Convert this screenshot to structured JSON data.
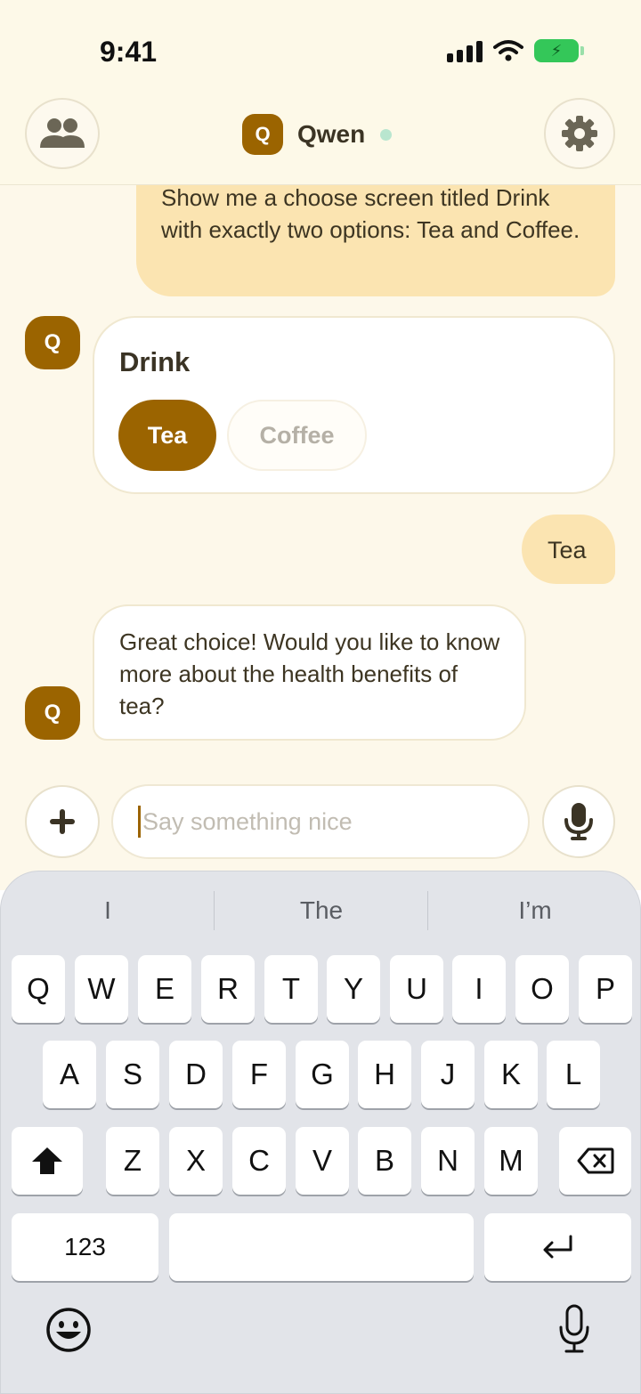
{
  "status_bar": {
    "time": "9:41"
  },
  "header": {
    "avatar_letter": "Q",
    "agent_name": "Qwen"
  },
  "messages": {
    "user_first": "Show me a choose screen titled Drink with exactly two options: Tea and Coffee.",
    "choose_card": {
      "avatar_letter": "Q",
      "title": "Drink",
      "options": [
        "Tea",
        "Coffee"
      ],
      "selected": "Tea"
    },
    "user_reply": "Tea",
    "bot_reply": "Great choice! Would you like to know more about the health benefits of tea?",
    "bot_avatar_letter": "Q"
  },
  "composer": {
    "placeholder": "Say something nice"
  },
  "keyboard": {
    "suggestions": [
      "I",
      "The",
      "I’m"
    ],
    "row1": [
      "Q",
      "W",
      "E",
      "R",
      "T",
      "Y",
      "U",
      "I",
      "O",
      "P"
    ],
    "row2": [
      "A",
      "S",
      "D",
      "F",
      "G",
      "H",
      "J",
      "K",
      "L"
    ],
    "row3": [
      "Z",
      "X",
      "C",
      "V",
      "B",
      "N",
      "M"
    ],
    "numbers_key": "123"
  },
  "icons": [
    "people-icon",
    "gear-icon",
    "plus-icon",
    "mic-icon",
    "shift-icon",
    "backspace-icon",
    "return-icon",
    "emoji-icon",
    "dictation-icon",
    "wifi-icon",
    "signal-icon",
    "battery-icon"
  ],
  "colors": {
    "accent": "#9b6400",
    "user_bubble": "#fbe4b1",
    "background": "#fdf8ea",
    "online": "#b9e6cf"
  }
}
